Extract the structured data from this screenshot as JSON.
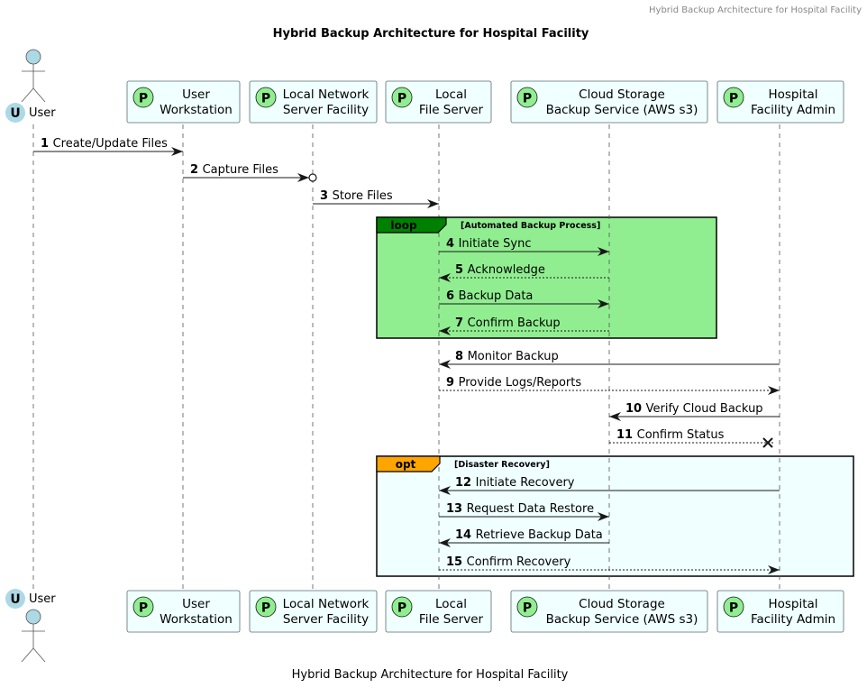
{
  "header": {
    "text": "Hybrid Backup Architecture for Hospital Facility"
  },
  "title": "Hybrid Backup Architecture for Hospital Facility",
  "footer": "Hybrid Backup Architecture for Hospital Facility",
  "colors": {
    "participant_fill": "#F0FFFF",
    "participant_border": "#5a6b73",
    "stereotype_circle": "#90EE90",
    "actor_fill": "#ADD8E6",
    "loop_fill": "#90EE90",
    "loop_tab": "#008000",
    "opt_fill": "#F0FFFF",
    "opt_tab": "#FFA500"
  },
  "participants": [
    {
      "id": "user",
      "kind": "actor",
      "badge": "U",
      "lines": [
        "User"
      ]
    },
    {
      "id": "ws",
      "kind": "participant",
      "badge": "P",
      "lines": [
        "User",
        "Workstation"
      ]
    },
    {
      "id": "lns",
      "kind": "participant",
      "badge": "P",
      "lines": [
        "Local Network",
        "Server Facility"
      ]
    },
    {
      "id": "lfs",
      "kind": "participant",
      "badge": "P",
      "lines": [
        "Local",
        "File Server"
      ]
    },
    {
      "id": "cloud",
      "kind": "participant",
      "badge": "P",
      "lines": [
        "Cloud Storage",
        "Backup Service (AWS s3)"
      ]
    },
    {
      "id": "admin",
      "kind": "participant",
      "badge": "P",
      "lines": [
        "Hospital",
        "Facility Admin"
      ]
    }
  ],
  "messages": [
    {
      "num": "1",
      "text": "Create/Update Files",
      "from": "user",
      "to": "ws",
      "style": "solid",
      "head": "arrow"
    },
    {
      "num": "2",
      "text": "Capture Files",
      "from": "ws",
      "to": "lns",
      "style": "solid",
      "head": "arrow-circle"
    },
    {
      "num": "3",
      "text": "Store Files",
      "from": "lns",
      "to": "lfs",
      "style": "solid",
      "head": "arrow"
    },
    {
      "num": "4",
      "text": "Initiate Sync",
      "from": "lfs",
      "to": "cloud",
      "style": "solid",
      "head": "arrow"
    },
    {
      "num": "5",
      "text": "Acknowledge",
      "from": "cloud",
      "to": "lfs",
      "style": "dashed",
      "head": "arrow"
    },
    {
      "num": "6",
      "text": "Backup Data",
      "from": "lfs",
      "to": "cloud",
      "style": "solid",
      "head": "arrow"
    },
    {
      "num": "7",
      "text": "Confirm Backup",
      "from": "cloud",
      "to": "lfs",
      "style": "dashed",
      "head": "arrow"
    },
    {
      "num": "8",
      "text": "Monitor Backup",
      "from": "admin",
      "to": "lfs",
      "style": "solid",
      "head": "arrow"
    },
    {
      "num": "9",
      "text": "Provide Logs/Reports",
      "from": "lfs",
      "to": "admin",
      "style": "dashed",
      "head": "arrow"
    },
    {
      "num": "10",
      "text": "Verify Cloud Backup",
      "from": "admin",
      "to": "cloud",
      "style": "solid",
      "head": "arrow"
    },
    {
      "num": "11",
      "text": "Confirm Status",
      "from": "cloud",
      "to": "admin",
      "style": "dashed",
      "head": "cross"
    },
    {
      "num": "12",
      "text": "Initiate Recovery",
      "from": "admin",
      "to": "lfs",
      "style": "solid",
      "head": "arrow"
    },
    {
      "num": "13",
      "text": "Request Data Restore",
      "from": "lfs",
      "to": "cloud",
      "style": "solid",
      "head": "arrow"
    },
    {
      "num": "14",
      "text": "Retrieve Backup Data",
      "from": "cloud",
      "to": "lfs",
      "style": "solid",
      "head": "arrow"
    },
    {
      "num": "15",
      "text": "Confirm Recovery",
      "from": "lfs",
      "to": "admin",
      "style": "dashed",
      "head": "arrow"
    }
  ],
  "fragments": [
    {
      "kind": "loop",
      "label": "loop",
      "condition": "[Automated Backup Process]",
      "first": 4,
      "last": 7
    },
    {
      "kind": "opt",
      "label": "opt",
      "condition": "[Disaster Recovery]",
      "first": 12,
      "last": 15
    }
  ]
}
